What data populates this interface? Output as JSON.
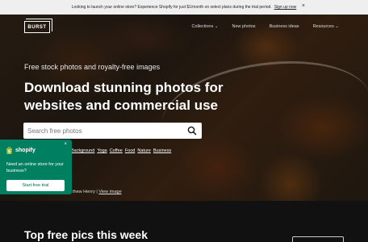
{
  "promo": {
    "message": "Looking to launch your online store? Experience Shopify for just $1/month on select plans during the trial period.",
    "link": "Sign up now",
    "close": "×"
  },
  "nav": {
    "logo": "BURST",
    "links": [
      "Collections ⌄",
      "New photos",
      "Business ideas",
      "Resources ⌄"
    ]
  },
  "hero": {
    "tagline": "Free stock photos and royalty-free images",
    "headline": "Download stunning photos for websites and commercial use",
    "search_placeholder": "Search free photos",
    "tags": [
      "Background",
      "Yoga",
      "Coffee",
      "Food",
      "Nature",
      "Business"
    ],
    "credit_text": "thew Henry |",
    "credit_link": "View image"
  },
  "shopify_popup": {
    "brand": "shopify",
    "close": "×",
    "message": "Need an online store for your business?",
    "button": "Start free trial",
    "color": "#008060"
  },
  "section": {
    "title": "Top free pics this week"
  }
}
